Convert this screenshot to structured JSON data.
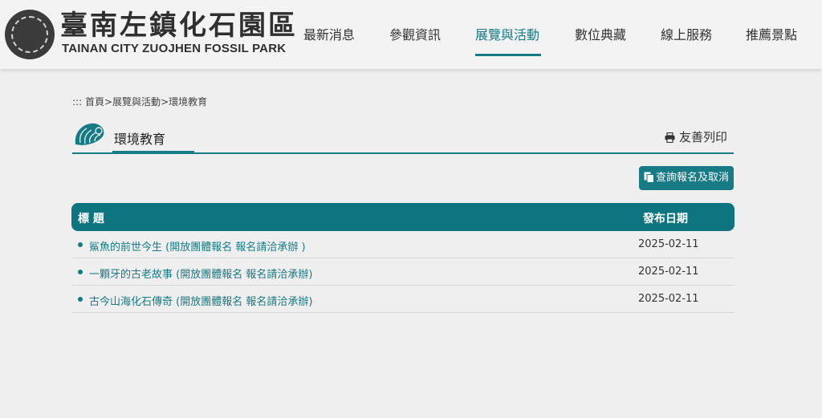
{
  "site": {
    "name_zh": "臺南左鎮化石園區",
    "name_en": "TAINAN CITY ZUOJHEN FOSSIL PARK"
  },
  "nav": {
    "items": [
      {
        "label": "最新消息"
      },
      {
        "label": "參觀資訊"
      },
      {
        "label": "展覽與活動",
        "active": true
      },
      {
        "label": "數位典藏"
      },
      {
        "label": "線上服務"
      },
      {
        "label": "推薦景點"
      }
    ]
  },
  "breadcrumb": {
    "marker": ":::",
    "items": [
      "首頁",
      "展覽與活動",
      "環境教育"
    ],
    "separator": ">"
  },
  "section": {
    "title": "環境教育",
    "print_label": "友善列印"
  },
  "query_button": {
    "label": "查詢報名及取消"
  },
  "table": {
    "headers": {
      "title": "標 題",
      "date": "發布日期"
    },
    "rows": [
      {
        "title": "鯊魚的前世今生 (開放團體報名 報名請洽承辦 )",
        "date": "2025-02-11"
      },
      {
        "title": "一顆牙的古老故事 (開放團體報名 報名請洽承辦)",
        "date": "2025-02-11"
      },
      {
        "title": "古今山海化石傳奇 (開放團體報名 報名請洽承辦)",
        "date": "2025-02-11"
      }
    ]
  },
  "colors": {
    "accent": "#167b85",
    "header_bg": "#0e7580",
    "page_bg": "#efefef"
  },
  "icons": [
    "logo-emblem-icon",
    "shell-icon",
    "printer-icon",
    "copy-icon",
    "bullet-icon"
  ]
}
